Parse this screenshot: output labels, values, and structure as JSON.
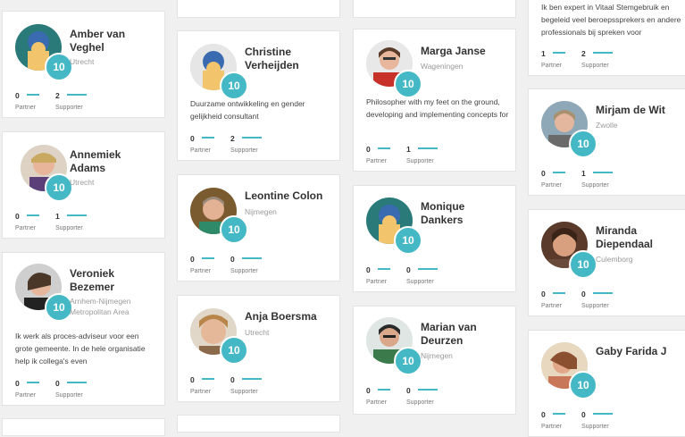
{
  "badge_color": "#45b8c6",
  "stat_labels": {
    "partner": "Partner",
    "supporter": "Supporter"
  },
  "col1": [
    {
      "name": "Amber van Veghel",
      "city": "Utrecht",
      "partner": "0",
      "supporter": "2",
      "badge": "10"
    },
    {
      "name": "Annemiek Adams",
      "city": "Utrecht",
      "partner": "0",
      "supporter": "1",
      "badge": "10"
    },
    {
      "name": "Veroniek Bezemer",
      "city": "Arnhem-Nijmegen Metropolitan Area",
      "desc": "Ik werk als proces-adviseur voor een grote gemeente. In de hele organisatie help ik collega's even",
      "partner": "0",
      "supporter": "0",
      "badge": "10"
    }
  ],
  "col2": [
    {
      "name": "Christine Verheijden",
      "desc": "Duurzame ontwikkeling en gender gelijkheid consultant",
      "partner": "0",
      "supporter": "2",
      "badge": "10"
    },
    {
      "name": "Leontine Colon",
      "city": "Nijmegen",
      "partner": "0",
      "supporter": "0",
      "badge": "10"
    },
    {
      "name": "Anja Boersma",
      "city": "Utrecht",
      "partner": "0",
      "supporter": "0",
      "badge": "10"
    }
  ],
  "col3": [
    {
      "name": "Marga Janse",
      "city": "Wageningen",
      "desc": "Philosopher with my feet on the ground, developing and implementing concepts for",
      "partner": "0",
      "supporter": "1",
      "badge": "10"
    },
    {
      "name": "Monique Dankers",
      "partner": "0",
      "supporter": "0",
      "badge": "10"
    },
    {
      "name": "Marian van Deurzen",
      "city": "Nijmegen",
      "partner": "0",
      "supporter": "0",
      "badge": "10"
    }
  ],
  "col4": [
    {
      "desc": "Ik ben expert in Vitaal Stemgebruik en begeleid veel beroepssprekers en andere professionals bij spreken voor",
      "partner": "1",
      "supporter": "2"
    },
    {
      "name": "Mirjam de Wit",
      "city": "Zwolle",
      "partner": "0",
      "supporter": "1",
      "badge": "10"
    },
    {
      "name": "Miranda Diependaal",
      "city": "Culemborg",
      "partner": "0",
      "supporter": "0",
      "badge": "10"
    },
    {
      "name": "Gaby Farida J",
      "partner": "0",
      "supporter": "0",
      "badge": "10"
    }
  ]
}
